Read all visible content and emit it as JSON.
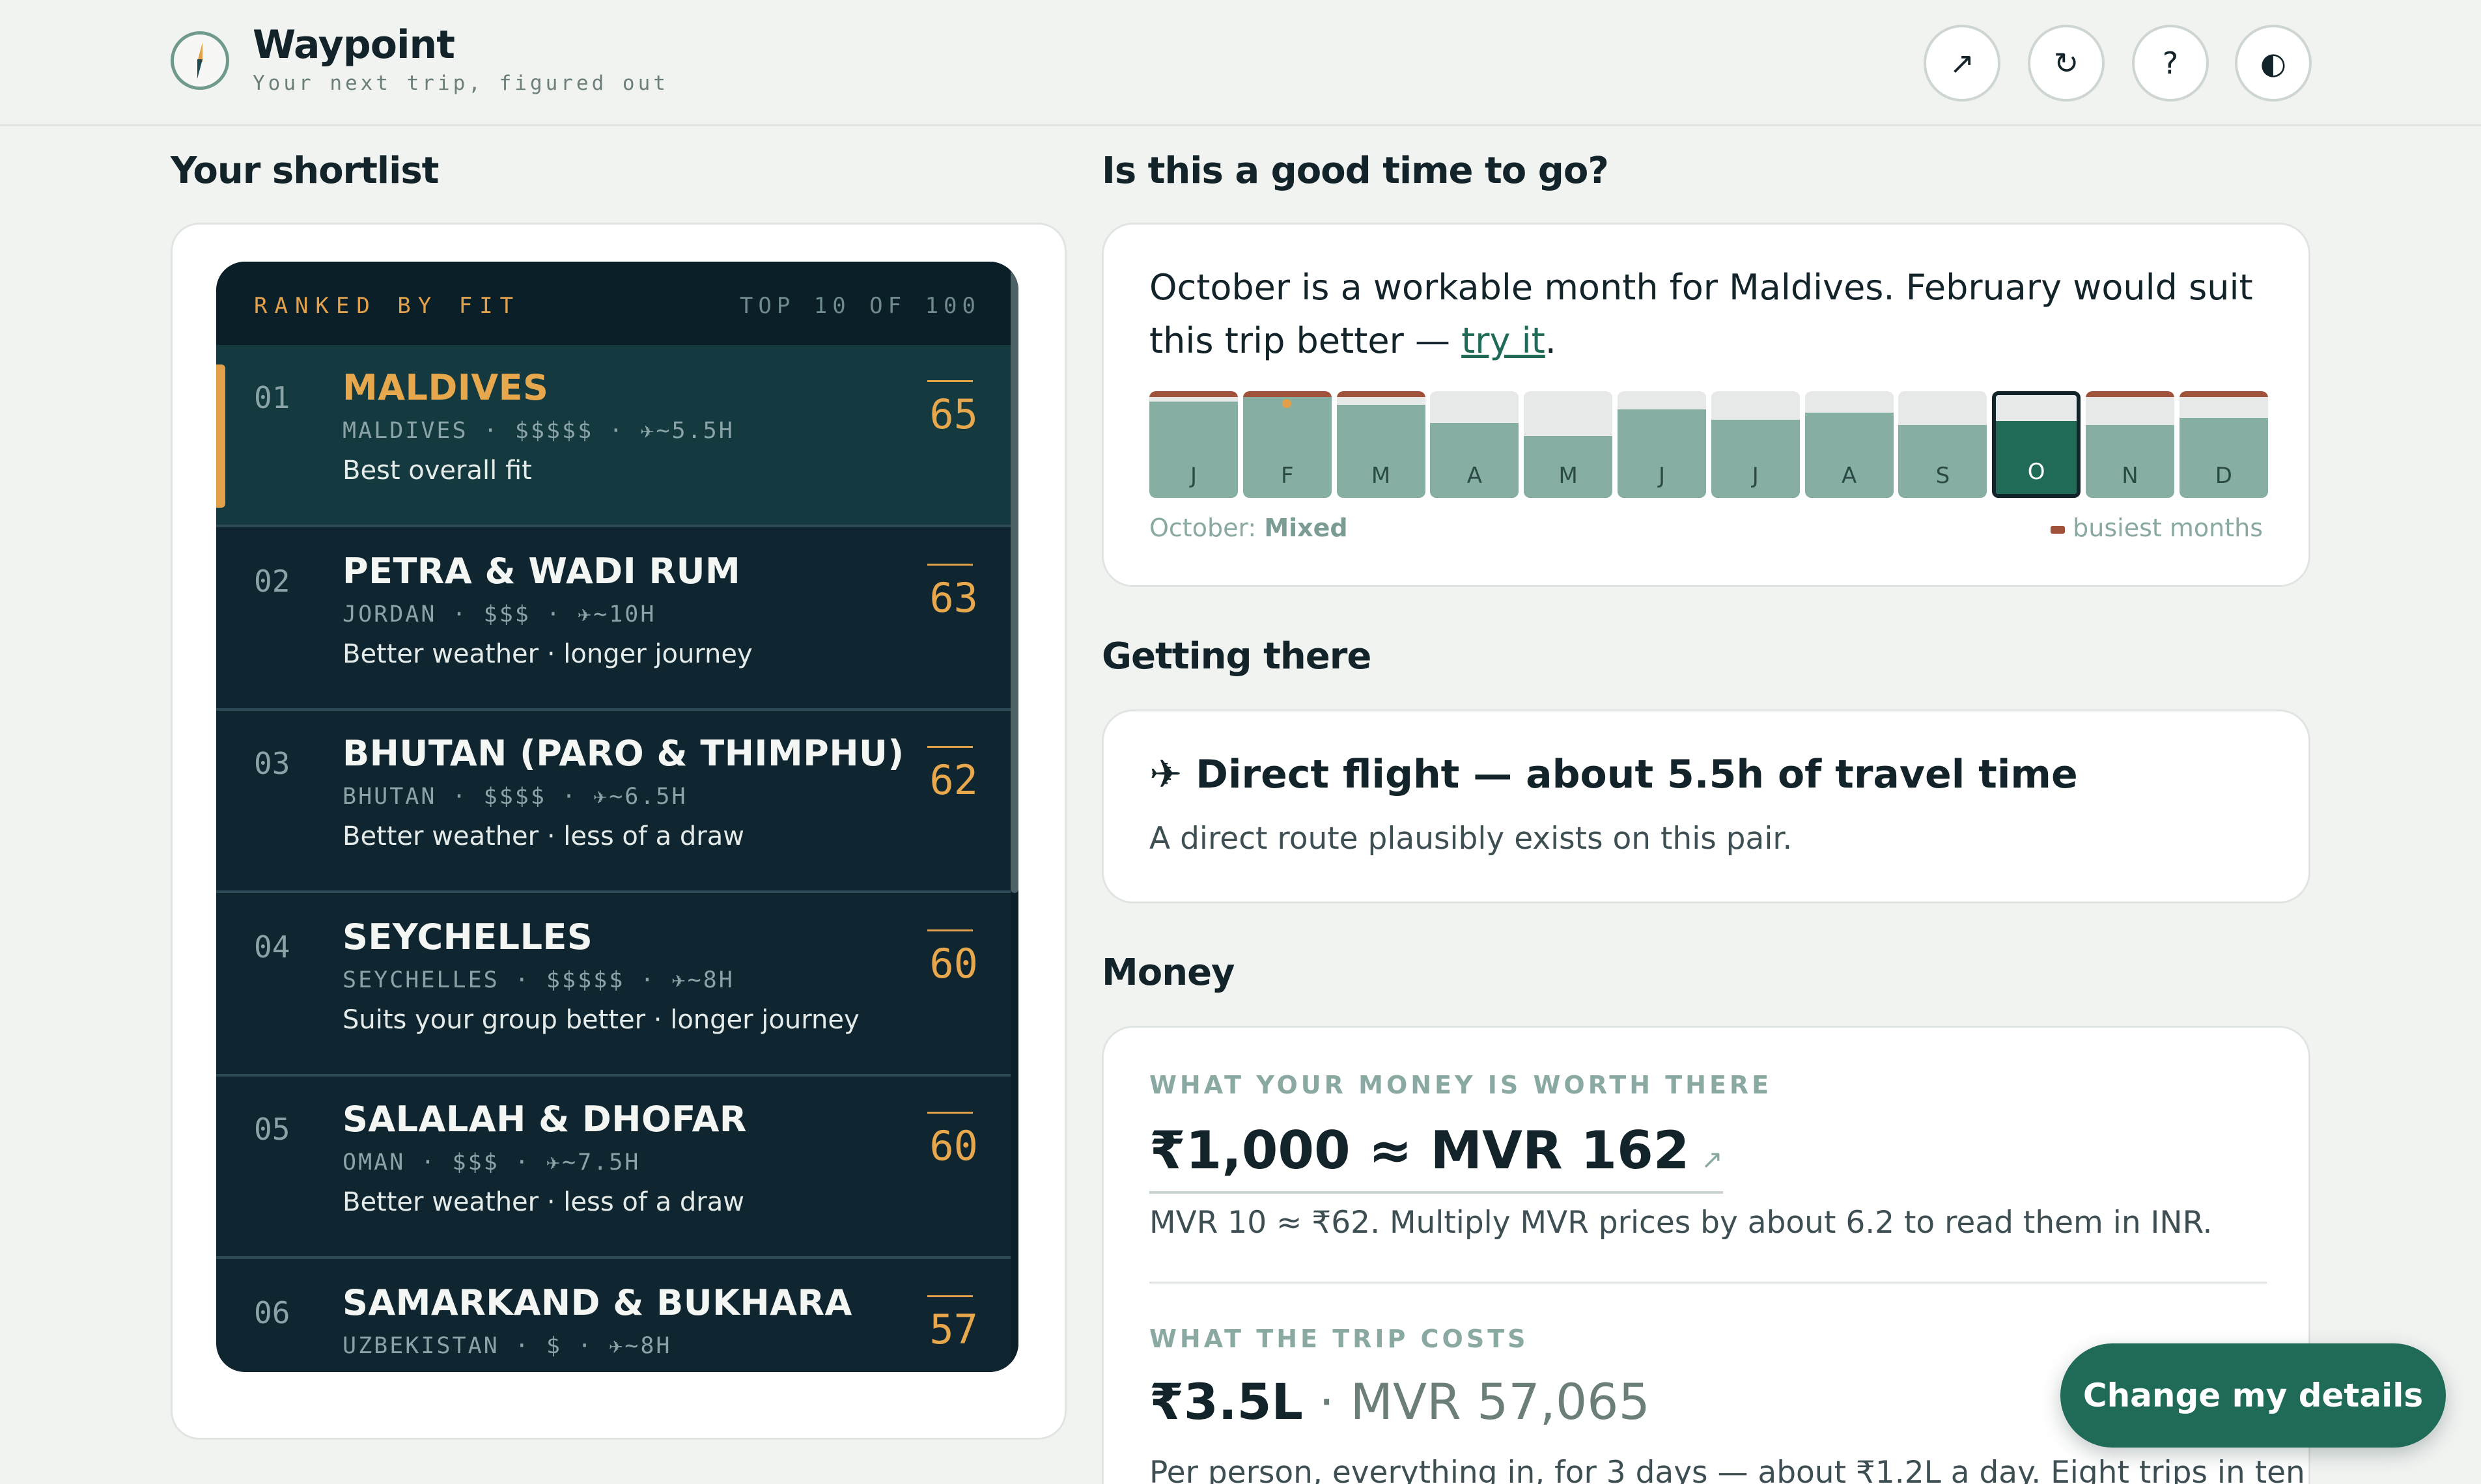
{
  "header": {
    "title": "Waypoint",
    "subtitle": "Your next trip, figured out",
    "buttons": [
      {
        "icon": "share-arrow-icon",
        "glyph": "↗"
      },
      {
        "icon": "reset-icon",
        "glyph": "↻"
      },
      {
        "icon": "help-icon",
        "glyph": "?"
      },
      {
        "icon": "theme-toggle-icon",
        "glyph": "◐"
      }
    ]
  },
  "shortlist": {
    "heading": "Your shortlist",
    "ranked_label": "RANKED BY FIT",
    "count_label": "TOP 10 OF 100",
    "items": [
      {
        "rank": "01",
        "name": "MALDIVES",
        "meta": "MALDIVES · $$$$$ · ✈~5.5H",
        "note": "Best overall fit",
        "score": "65",
        "selected": true
      },
      {
        "rank": "02",
        "name": "PETRA & WADI RUM",
        "meta": "JORDAN · $$$ · ✈~10H",
        "note": "Better weather · longer journey",
        "score": "63"
      },
      {
        "rank": "03",
        "name": "BHUTAN (PARO & THIMPHU)",
        "meta": "BHUTAN · $$$$ · ✈~6.5H",
        "note": "Better weather · less of a draw",
        "score": "62"
      },
      {
        "rank": "04",
        "name": "SEYCHELLES",
        "meta": "SEYCHELLES · $$$$$ · ✈~8H",
        "note": "Suits your group better · longer journey",
        "score": "60"
      },
      {
        "rank": "05",
        "name": "SALALAH & DHOFAR",
        "meta": "OMAN · $$$ · ✈~7.5H",
        "note": "Better weather · less of a draw",
        "score": "60"
      },
      {
        "rank": "06",
        "name": "SAMARKAND & BUKHARA",
        "meta": "UZBEKISTAN · $ · ✈~8H",
        "note": "",
        "score": "57"
      }
    ]
  },
  "timing": {
    "heading": "Is this a good time to go?",
    "text_before": "October is a workable month for Maldives. February would suit this trip better — ",
    "link": "try it",
    "text_after": ".",
    "months": [
      {
        "label": "J",
        "level": 0.9,
        "busy": true
      },
      {
        "label": "F",
        "level": 0.95,
        "busy": true,
        "marker": true
      },
      {
        "label": "M",
        "level": 0.87,
        "busy": true
      },
      {
        "label": "A",
        "level": 0.7,
        "busy": false
      },
      {
        "label": "M",
        "level": 0.58,
        "busy": false
      },
      {
        "label": "J",
        "level": 0.83,
        "busy": false
      },
      {
        "label": "J",
        "level": 0.73,
        "busy": false
      },
      {
        "label": "A",
        "level": 0.8,
        "busy": false
      },
      {
        "label": "S",
        "level": 0.68,
        "busy": false
      },
      {
        "label": "O",
        "level": 0.68,
        "busy": false,
        "current": true
      },
      {
        "label": "N",
        "level": 0.68,
        "busy": true
      },
      {
        "label": "D",
        "level": 0.75,
        "busy": true
      }
    ],
    "status_month": "October:",
    "status_value": "Mixed",
    "legend_label": "busiest months"
  },
  "getting_there": {
    "heading": "Getting there",
    "title": "✈ Direct flight — about 5.5h of travel time",
    "subtitle": "A direct route plausibly exists on this pair."
  },
  "money": {
    "heading": "Money",
    "worth_label": "WHAT YOUR MONEY IS WORTH THERE",
    "rate": "₹1,000 ≈ MVR 162",
    "rate_arrow": "↗",
    "rate_desc": "MVR 10 ≈ ₹62. Multiply MVR prices by about 6.2 to read them in INR.",
    "cost_label": "WHAT THE TRIP COSTS",
    "cost_inr": "₹3.5L",
    "cost_sep": " · ",
    "cost_mvr": "MVR 57,065",
    "cost_desc": "Per person, everything in, for 3 days — about ₹1.2L a day. Eight trips in ten"
  },
  "fab": {
    "label": "Change my details"
  },
  "colors": {
    "accent": "#1f6b57",
    "gold": "#e2a04a",
    "navy": "#0f2631",
    "busy": "#a0533a"
  }
}
